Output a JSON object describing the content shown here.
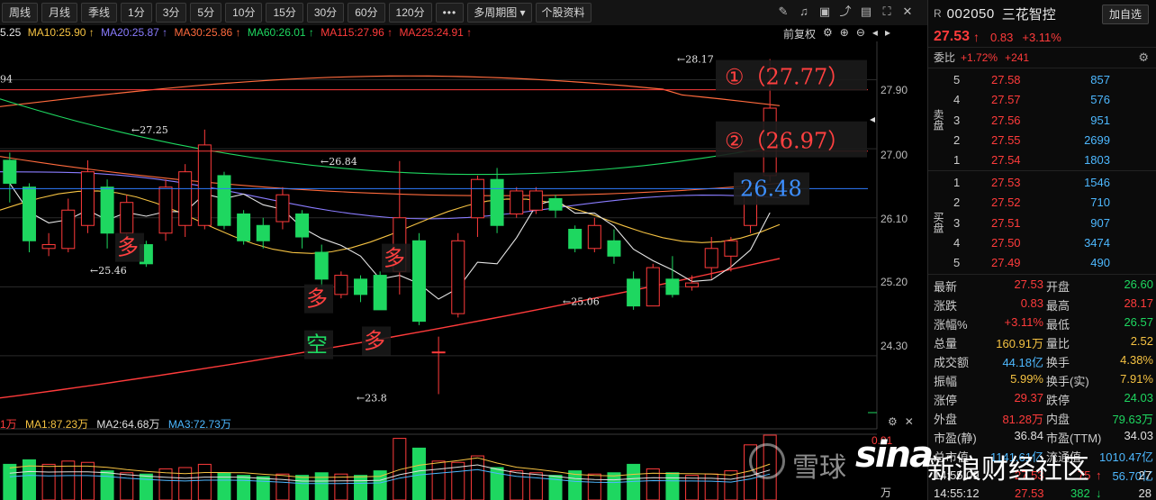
{
  "toolbar": {
    "buttons": [
      "周线",
      "月线",
      "季线",
      "1分",
      "3分",
      "5分",
      "10分",
      "15分",
      "30分",
      "60分",
      "120分",
      "•••",
      "多周期图 ▾",
      "个股资料"
    ]
  },
  "ma_legend": [
    {
      "text": "5.25",
      "color": "#e6e6e6"
    },
    {
      "text": "MA10:25.90 ↑",
      "color": "#f5c242"
    },
    {
      "text": "MA20:25.87 ↑",
      "color": "#8a7cff"
    },
    {
      "text": "MA30:25.86 ↑",
      "color": "#ff6a3d"
    },
    {
      "text": "MA60:26.01 ↑",
      "color": "#1ed760"
    },
    {
      "text": "MA115:27.96 ↑",
      "color": "#ff3b3b"
    },
    {
      "text": "MA225:24.91 ↑",
      "color": "#ff3b3b"
    }
  ],
  "chart_controls": {
    "adjust_label": "前复权"
  },
  "price_axis": [
    "27.90",
    "27.00",
    "26.10",
    "25.20",
    "24.30"
  ],
  "annotations": {
    "hline1_label": "①（27.77）",
    "hline2_label": "②（26.97）",
    "hline3_label": "26.48",
    "left_marker": "94",
    "price_marks": [
      "←28.17",
      "←27.25",
      "←26.84",
      "←25.46",
      "←25.06",
      "←23.8"
    ],
    "chars": [
      "多",
      "多",
      "多",
      "多",
      "空"
    ]
  },
  "chart_data": {
    "type": "candlestick",
    "ylim": [
      23.7,
      28.4
    ],
    "candles": [
      {
        "o": 26.85,
        "h": 26.95,
        "c": 26.55,
        "l": 26.3
      },
      {
        "o": 26.5,
        "h": 26.55,
        "c": 25.8,
        "l": 25.65
      },
      {
        "o": 25.7,
        "h": 25.9,
        "c": 25.75,
        "l": 25.6
      },
      {
        "o": 25.7,
        "h": 26.35,
        "c": 26.2,
        "l": 25.65
      },
      {
        "o": 26.0,
        "h": 26.85,
        "c": 26.7,
        "l": 25.9
      },
      {
        "o": 26.5,
        "h": 26.6,
        "c": 25.9,
        "l": 25.7
      },
      {
        "o": 25.9,
        "h": 26.4,
        "c": 26.3,
        "l": 25.8
      },
      {
        "o": 25.75,
        "h": 25.8,
        "c": 25.5,
        "l": 25.46
      },
      {
        "o": 25.9,
        "h": 26.6,
        "c": 26.5,
        "l": 25.8
      },
      {
        "o": 26.0,
        "h": 26.8,
        "c": 26.7,
        "l": 25.85
      },
      {
        "o": 26.0,
        "h": 27.25,
        "c": 27.05,
        "l": 25.95
      },
      {
        "o": 26.65,
        "h": 26.7,
        "c": 26.0,
        "l": 25.95
      },
      {
        "o": 26.15,
        "h": 26.2,
        "c": 25.8,
        "l": 25.75
      },
      {
        "o": 26.0,
        "h": 26.1,
        "c": 25.8,
        "l": 25.7
      },
      {
        "o": 26.05,
        "h": 26.5,
        "c": 26.4,
        "l": 25.95
      },
      {
        "o": 26.15,
        "h": 26.2,
        "c": 25.85,
        "l": 25.7
      },
      {
        "o": 25.65,
        "h": 25.75,
        "c": 25.3,
        "l": 25.2
      },
      {
        "o": 25.1,
        "h": 25.4,
        "c": 25.35,
        "l": 25.05
      },
      {
        "o": 25.3,
        "h": 25.35,
        "c": 25.1,
        "l": 25.0
      },
      {
        "o": 25.35,
        "h": 25.4,
        "c": 24.9,
        "l": 24.9
      },
      {
        "o": 25.4,
        "h": 26.84,
        "c": 26.1,
        "l": 25.1
      },
      {
        "o": 25.8,
        "h": 25.9,
        "c": 24.75,
        "l": 24.7
      },
      {
        "o": 24.35,
        "h": 24.55,
        "c": 24.35,
        "l": 23.8
      },
      {
        "o": 24.85,
        "h": 25.9,
        "c": 25.8,
        "l": 24.8
      },
      {
        "o": 26.1,
        "h": 26.65,
        "c": 26.6,
        "l": 25.85
      },
      {
        "o": 26.6,
        "h": 26.75,
        "c": 26.0,
        "l": 25.9
      },
      {
        "o": 26.15,
        "h": 26.5,
        "c": 26.45,
        "l": 26.1
      },
      {
        "o": 26.2,
        "h": 26.5,
        "c": 26.45,
        "l": 26.15
      },
      {
        "o": 26.35,
        "h": 26.4,
        "c": 26.2,
        "l": 26.1
      },
      {
        "o": 25.95,
        "h": 26.0,
        "c": 25.7,
        "l": 25.65
      },
      {
        "o": 25.7,
        "h": 26.1,
        "c": 26.0,
        "l": 25.65
      },
      {
        "o": 25.8,
        "h": 25.95,
        "c": 25.6,
        "l": 25.5
      },
      {
        "o": 25.3,
        "h": 25.4,
        "c": 24.95,
        "l": 24.9
      },
      {
        "o": 24.95,
        "h": 25.5,
        "c": 25.45,
        "l": 24.95
      },
      {
        "o": 25.3,
        "h": 25.6,
        "c": 25.1,
        "l": 25.06
      },
      {
        "o": 25.2,
        "h": 25.35,
        "c": 25.25,
        "l": 25.15
      },
      {
        "o": 25.45,
        "h": 25.85,
        "c": 25.7,
        "l": 25.3
      },
      {
        "o": 25.6,
        "h": 25.85,
        "c": 25.8,
        "l": 25.4
      },
      {
        "o": 26.0,
        "h": 26.6,
        "c": 26.55,
        "l": 25.9
      },
      {
        "o": 26.65,
        "h": 28.17,
        "c": 27.53,
        "l": 26.57
      }
    ]
  },
  "volume_legend": [
    {
      "text": "1万",
      "color": "#ff3b3b"
    },
    {
      "text": "MA1:87.23万",
      "color": "#f5c242"
    },
    {
      "text": "MA2:64.68万",
      "color": "#e0e0e0"
    },
    {
      "text": "MA3:72.73万",
      "color": "#4db8ff"
    }
  ],
  "volume_axis_top": "0.91",
  "volume_unit": "万",
  "panel": {
    "r_mark": "R",
    "code": "002050",
    "name": "三花智控",
    "add_btn": "加自选",
    "price": "27.53",
    "arrow": "↑",
    "change": "0.83",
    "change_pct": "+3.11%",
    "wb_label": "委比",
    "wb_pct": "+1.72%",
    "wb_diff": "+241",
    "sell_label": "卖盘",
    "buy_label": "买盘",
    "sell": [
      {
        "lv": "5",
        "price": "27.58",
        "vol": "857"
      },
      {
        "lv": "4",
        "price": "27.57",
        "vol": "576"
      },
      {
        "lv": "3",
        "price": "27.56",
        "vol": "951"
      },
      {
        "lv": "2",
        "price": "27.55",
        "vol": "2699"
      },
      {
        "lv": "1",
        "price": "27.54",
        "vol": "1803"
      }
    ],
    "buy": [
      {
        "lv": "1",
        "price": "27.53",
        "vol": "1546"
      },
      {
        "lv": "2",
        "price": "27.52",
        "vol": "710"
      },
      {
        "lv": "3",
        "price": "27.51",
        "vol": "907"
      },
      {
        "lv": "4",
        "price": "27.50",
        "vol": "3474"
      },
      {
        "lv": "5",
        "price": "27.49",
        "vol": "490"
      }
    ],
    "stats": [
      {
        "k1": "最新",
        "v1": "27.53",
        "c1": "red",
        "k2": "开盘",
        "v2": "26.60",
        "c2": "green"
      },
      {
        "k1": "涨跌",
        "v1": "0.83",
        "c1": "red",
        "k2": "最高",
        "v2": "28.17",
        "c2": "red"
      },
      {
        "k1": "涨幅%",
        "v1": "+3.11%",
        "c1": "red",
        "k2": "最低",
        "v2": "26.57",
        "c2": "green"
      },
      {
        "k1": "总量",
        "v1": "160.91万",
        "c1": "yellow",
        "k2": "量比",
        "v2": "2.52",
        "c2": "yellow"
      },
      {
        "k1": "成交额",
        "v1": "44.18亿",
        "c1": "blue",
        "k2": "换手",
        "v2": "4.38%",
        "c2": "yellow"
      },
      {
        "k1": "振幅",
        "v1": "5.99%",
        "c1": "yellow",
        "k2": "换手(实)",
        "v2": "7.91%",
        "c2": "yellow"
      },
      {
        "k1": "涨停",
        "v1": "29.37",
        "c1": "red",
        "k2": "跌停",
        "v2": "24.03",
        "c2": "green"
      },
      {
        "k1": "外盘",
        "v1": "81.28万",
        "c1": "red",
        "k2": "内盘",
        "v2": "79.63万",
        "c2": "green"
      },
      {
        "k1": "市盈(静)",
        "v1": "36.84",
        "c1": "white",
        "k2": "市盈(TTM)",
        "v2": "34.03",
        "c2": "white"
      },
      {
        "k1": "总市值",
        "v1": "1141.61亿",
        "c1": "blue",
        "k2": "流通值",
        "v2": "1010.47亿",
        "c2": "blue"
      },
      {
        "k1": "",
        "v1": "",
        "c1": "white",
        "k2": "",
        "v2": "56.70亿",
        "c2": "blue"
      }
    ],
    "tick_row1": {
      "time": "14:55:09",
      "price": "27.53",
      "vol": "75",
      "arrow": "↑",
      "num": "27"
    },
    "tick_row2": {
      "time": "14:55:12",
      "price": "27.53",
      "vol": "382",
      "arrow": "↓",
      "num": "28"
    }
  },
  "watermark": {
    "t1": "雪球",
    "t2": "sina",
    "t3": "新浪财经社区"
  }
}
